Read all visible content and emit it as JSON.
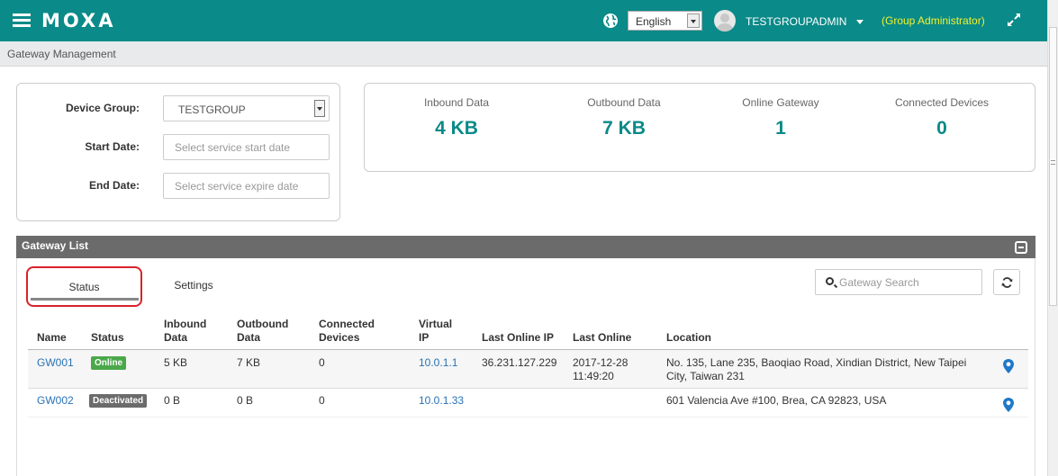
{
  "header": {
    "brand": "MOXA",
    "language": "English",
    "username": "TESTGROUPADMIN",
    "role": "(Group Administrator)"
  },
  "breadcrumb": "Gateway Management",
  "filters": {
    "device_group_label": "Device Group:",
    "device_group_value": "TESTGROUP",
    "start_date_label": "Start Date:",
    "start_date_placeholder": "Select service start date",
    "end_date_label": "End Date:",
    "end_date_placeholder": "Select service expire date"
  },
  "stats": [
    {
      "label": "Inbound Data",
      "value": "4 KB"
    },
    {
      "label": "Outbound Data",
      "value": "7 KB"
    },
    {
      "label": "Online Gateway",
      "value": "1"
    },
    {
      "label": "Connected Devices",
      "value": "0"
    }
  ],
  "gateway_list": {
    "title": "Gateway List",
    "tabs": [
      "Status",
      "Settings"
    ],
    "search_placeholder": "Gateway Search",
    "columns": [
      {
        "l1": "",
        "l2": "Name"
      },
      {
        "l1": "",
        "l2": "Status"
      },
      {
        "l1": "Inbound",
        "l2": "Data"
      },
      {
        "l1": "Outbound",
        "l2": "Data"
      },
      {
        "l1": "Connected",
        "l2": "Devices"
      },
      {
        "l1": "Virtual",
        "l2": "IP"
      },
      {
        "l1": "",
        "l2": "Last Online IP"
      },
      {
        "l1": "",
        "l2": "Last Online"
      },
      {
        "l1": "",
        "l2": "Location"
      }
    ],
    "rows": [
      {
        "name": "GW001",
        "status": "Online",
        "inbound": "5 KB",
        "outbound": "7 KB",
        "devices": "0",
        "virtual_ip": "10.0.1.1",
        "last_ip": "36.231.127.229",
        "last_online_date": "2017-12-28",
        "last_online_time": "11:49:20",
        "location_l1": "No. 135, Lane 235, Baoqiao Road, Xindian District, New Taipei",
        "location_l2": "City, Taiwan 231"
      },
      {
        "name": "GW002",
        "status": "Deactivated",
        "inbound": "0 B",
        "outbound": "0 B",
        "devices": "0",
        "virtual_ip": "10.0.1.33",
        "last_ip": "",
        "last_online_date": "",
        "last_online_time": "",
        "location_l1": "601 Valencia Ave #100, Brea, CA 92823, USA",
        "location_l2": ""
      }
    ]
  },
  "colors": {
    "topbar": "#0a8a88",
    "accent": "#0a8a88",
    "role_text": "#f2f22e",
    "online_badge": "#4aa84a",
    "deactivated_badge": "#6b6b6b",
    "link": "#2a72b5",
    "pin": "#1f78c8",
    "highlight_ring": "#d9222a"
  }
}
